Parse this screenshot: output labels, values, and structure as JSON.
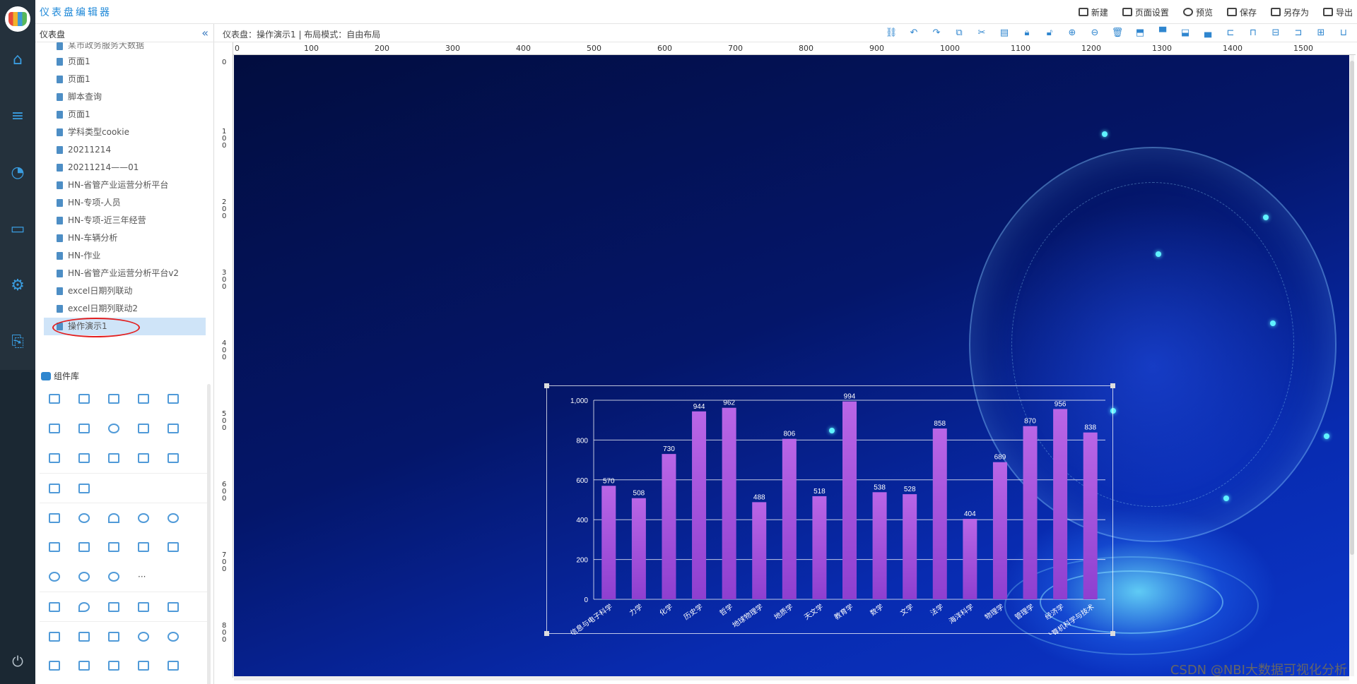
{
  "app": {
    "title": "仪表盘编辑器"
  },
  "toolbar": {
    "new": "新建",
    "page_settings": "页面设置",
    "preview": "预览",
    "save": "保存",
    "save_as": "另存为",
    "export": "导出"
  },
  "panel": {
    "title": "仪表盘",
    "partial_item": "某市政务服务大数据",
    "items": [
      {
        "label": "页面1"
      },
      {
        "label": "页面1"
      },
      {
        "label": "脚本查询"
      },
      {
        "label": "页面1"
      },
      {
        "label": "学科类型cookie"
      },
      {
        "label": "20211214"
      },
      {
        "label": "20211214——01"
      },
      {
        "label": "HN-省管产业运营分析平台"
      },
      {
        "label": "HN-专项-人员"
      },
      {
        "label": "HN-专项-近三年经营"
      },
      {
        "label": "HN-车辆分析"
      },
      {
        "label": "HN-作业"
      },
      {
        "label": "HN-省管产业运营分析平台v2"
      },
      {
        "label": "excel日期列联动"
      },
      {
        "label": "excel日期列联动2"
      }
    ],
    "selected_item": "操作演示1",
    "library_title": "组件库"
  },
  "breadcrumb": "仪表盘：操作演示1 | 布局模式：自由布局",
  "ruler": {
    "h": [
      "0",
      "100",
      "200",
      "300",
      "400",
      "500",
      "600",
      "700",
      "800",
      "900",
      "1000",
      "1100",
      "1200",
      "1300",
      "1400",
      "1500"
    ],
    "v": [
      "0",
      "100",
      "200",
      "300",
      "400",
      "500",
      "600",
      "700",
      "800"
    ]
  },
  "chart_data": {
    "type": "bar",
    "categories": [
      "信息与电子科学",
      "力学",
      "化学",
      "历史学",
      "哲学",
      "地球物理学",
      "地质学",
      "天文学",
      "教育学",
      "数学",
      "文学",
      "法学",
      "海洋科学",
      "物理学",
      "管理学",
      "经济学",
      "计算机科学与技术"
    ],
    "values": [
      570,
      508,
      730,
      944,
      962,
      488,
      806,
      518,
      994,
      538,
      528,
      858,
      404,
      689,
      870,
      956,
      838
    ],
    "yticks": [
      "0",
      "200",
      "400",
      "600",
      "800",
      "1,000"
    ],
    "ylim": [
      0,
      1000
    ],
    "colors": {
      "bar_top": "#b966e6",
      "bar_bottom": "#8e3fd0",
      "text": "#ffffff",
      "grid": "rgba(255,255,255,0.75)"
    }
  },
  "watermark": "CSDN @NBI大数据可视化分析"
}
